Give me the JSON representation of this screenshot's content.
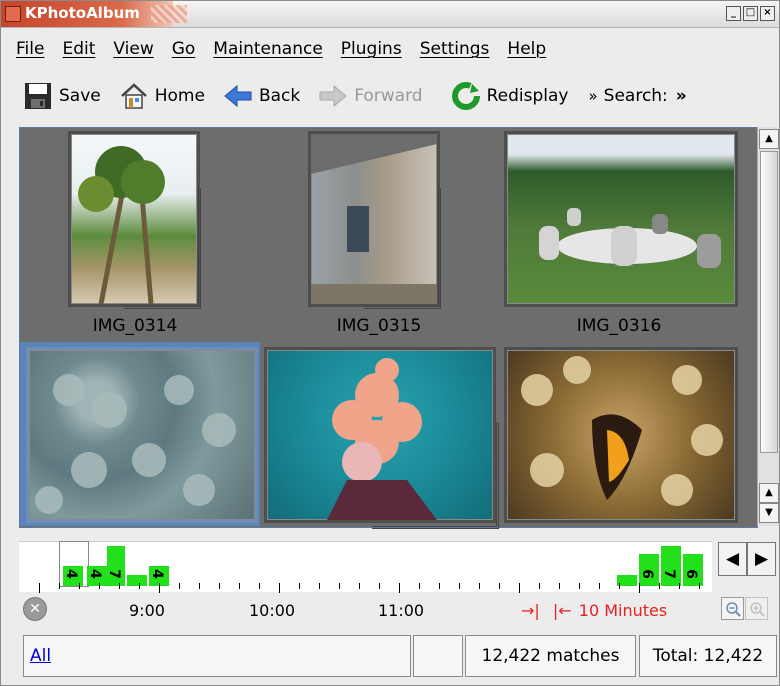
{
  "window": {
    "title": "KPhotoAlbum"
  },
  "menu": [
    "File",
    "Edit",
    "View",
    "Go",
    "Maintenance",
    "Plugins",
    "Settings",
    "Help"
  ],
  "toolbar": {
    "save": "Save",
    "home": "Home",
    "back": "Back",
    "forward": "Forward",
    "redisplay": "Redisplay",
    "search_prefix": "»",
    "search": "Search:",
    "more": "»"
  },
  "thumbnails": [
    {
      "caption": "IMG_0314"
    },
    {
      "caption": "IMG_0315"
    },
    {
      "caption": "IMG_0316"
    },
    {
      "caption": ""
    },
    {
      "caption": ""
    },
    {
      "caption": ""
    }
  ],
  "timeline": {
    "counts_left": [
      "4",
      "4",
      "7",
      "",
      "4"
    ],
    "counts_right": [
      "",
      "6",
      "7",
      "6"
    ],
    "labels": [
      "9:00",
      "10:00",
      "11:00"
    ],
    "unit": "10 Minutes"
  },
  "status": {
    "filter": "All",
    "matches": "12,422 matches",
    "total": "Total: 12,422"
  }
}
